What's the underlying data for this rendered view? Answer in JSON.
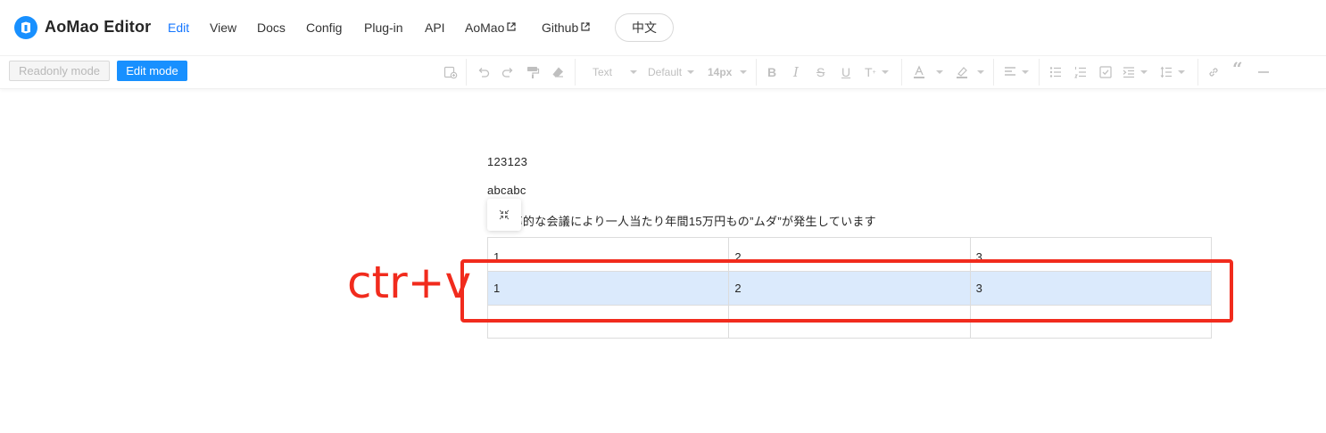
{
  "header": {
    "brand": "AoMao Editor",
    "nav": [
      {
        "label": "Edit",
        "active": true,
        "external": false
      },
      {
        "label": "View",
        "active": false,
        "external": false
      },
      {
        "label": "Docs",
        "active": false,
        "external": false
      },
      {
        "label": "Config",
        "active": false,
        "external": false
      },
      {
        "label": "Plug-in",
        "active": false,
        "external": false
      },
      {
        "label": "API",
        "active": false,
        "external": false
      },
      {
        "label": "AoMao",
        "active": false,
        "external": true
      },
      {
        "label": "Github",
        "active": false,
        "external": true
      }
    ],
    "language_button": "中文"
  },
  "toolbar": {
    "readonly_mode": "Readonly mode",
    "edit_mode": "Edit mode",
    "heading_select": "Text",
    "font_family_select": "Default",
    "font_size_select": "14px",
    "icons": [
      "insert-icon",
      "undo-icon",
      "redo-icon",
      "paintformat-icon",
      "clear-format-icon",
      "bold-icon",
      "italic-icon",
      "strikethrough-icon",
      "underline-icon",
      "superscript-icon",
      "font-color-icon",
      "background-color-icon",
      "alignment-icon",
      "unordered-list-icon",
      "ordered-list-icon",
      "task-list-icon",
      "indent-icon",
      "line-height-icon",
      "link-icon",
      "quote-icon",
      "horizontal-rule-icon"
    ]
  },
  "document": {
    "paragraphs": [
      "123123",
      "abcabc",
      "非効率的な会議により一人当たり年間15万円もの”ムダ”が発生しています"
    ],
    "table": [
      [
        "1",
        "2",
        "3"
      ],
      [
        "1",
        "2",
        "3"
      ],
      [
        "",
        "",
        ""
      ]
    ]
  },
  "annotation": {
    "text": "ctr+v",
    "color": "#f12b1d"
  },
  "colors": {
    "accent": "#1890ff",
    "selection": "#dbeafc"
  }
}
